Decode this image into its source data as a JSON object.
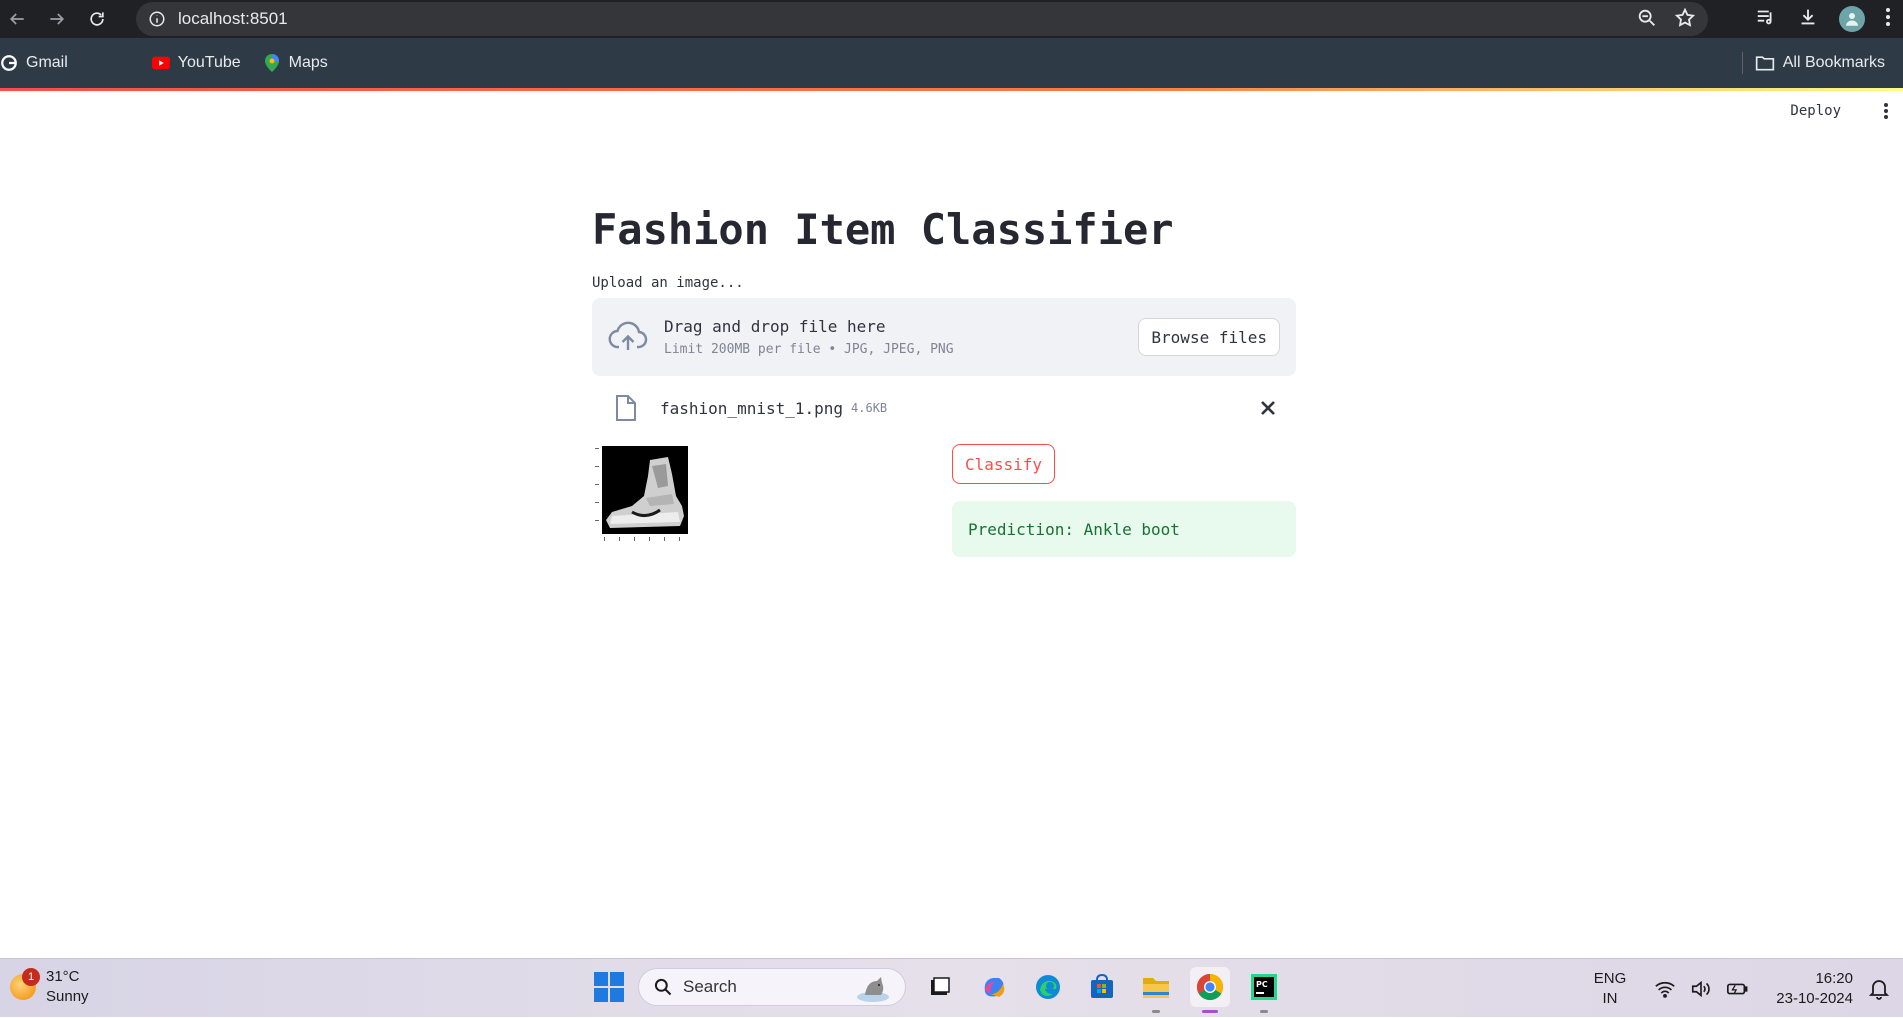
{
  "browser": {
    "url": "localhost:8501",
    "bookmarks": [
      {
        "label": "Gmail",
        "icon": "google-icon"
      },
      {
        "label": "YouTube",
        "icon": "youtube-icon"
      },
      {
        "label": "Maps",
        "icon": "maps-icon"
      }
    ],
    "all_bookmarks_label": "All Bookmarks"
  },
  "app": {
    "deploy_label": "Deploy",
    "title": "Fashion Item Classifier",
    "upload_label": "Upload an image...",
    "dropzone": {
      "primary_text": "Drag and drop file here",
      "secondary_text": "Limit 200MB per file • JPG, JPEG, PNG",
      "browse_label": "Browse files"
    },
    "uploaded_file": {
      "name": "fashion_mnist_1.png",
      "size": "4.6KB"
    },
    "classify_label": "Classify",
    "prediction_text": "Prediction: Ankle boot",
    "colors": {
      "primary": "#ff4b4b",
      "success_bg": "#e8f9ee",
      "success_text": "#177233",
      "dropzone_bg": "#f0f2f6"
    }
  },
  "taskbar": {
    "weather": {
      "temp": "31°C",
      "condition": "Sunny",
      "badge": "1"
    },
    "search_placeholder": "Search",
    "language": {
      "line1": "ENG",
      "line2": "IN"
    },
    "clock": {
      "time": "16:20",
      "date": "23-10-2024"
    }
  }
}
